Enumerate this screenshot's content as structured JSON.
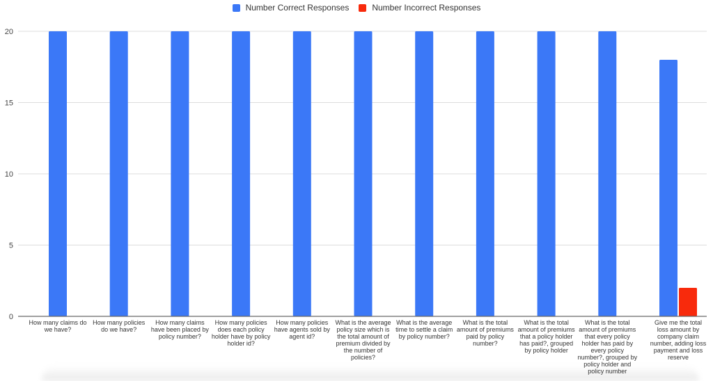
{
  "chart_data": {
    "type": "bar",
    "title": "",
    "xlabel": "",
    "ylabel": "",
    "ylim": [
      0,
      20
    ],
    "yticks": [
      0,
      5,
      10,
      15,
      20
    ],
    "grid": true,
    "legend_position": "top-center",
    "categories": [
      "How many claims do we have?",
      "How many policies do we have?",
      "How many claims have been placed by policy number?",
      "How many policies does each policy holder have by policy holder id?",
      "How many policies have agents sold by agent id?",
      "What is the average policy size which is the total amount of premium divided by the number of policies?",
      "What is the average time to settle a claim by policy number?",
      "What is the total amount of premiums paid by policy number?",
      "What is the total amount of premiums that a policy holder has paid?, grouped by policy holder",
      "What is the total amount of premiums that every policy holder has paid by every policy number?, grouped by policy holder and policy number",
      "Give me the total loss amount by company claim number, adding loss payment and loss reserve"
    ],
    "series": [
      {
        "name": "Number Correct Responses",
        "color": "#3b78f7",
        "values": [
          20,
          20,
          20,
          20,
          20,
          20,
          20,
          20,
          20,
          20,
          18
        ]
      },
      {
        "name": "Number Incorrect Responses",
        "color": "#f82a0c",
        "values": [
          0,
          0,
          0,
          0,
          0,
          0,
          0,
          0,
          0,
          0,
          2
        ]
      }
    ]
  }
}
